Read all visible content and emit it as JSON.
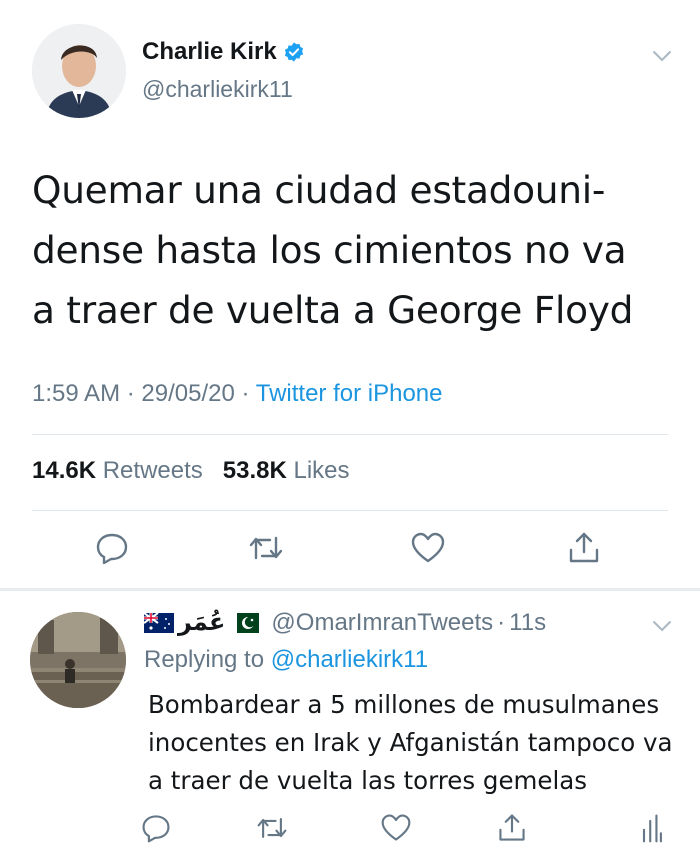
{
  "main_tweet": {
    "display_name": "Charlie Kirk",
    "handle": "@charliekirk11",
    "text": "Quemar una ciudad estadouni-\ndense hasta los cimientos no va\na traer de vuelta a George Floyd",
    "time": "1:59 AM",
    "date": "29/05/20",
    "separator": "·",
    "source": "Twitter for iPhone",
    "retweets_count": "14.6K",
    "retweets_label": "Retweets",
    "likes_count": "53.8K",
    "likes_label": "Likes"
  },
  "reply": {
    "display_name": "عُمَر",
    "handle": "@OmarImranTweets",
    "time": "11s",
    "separator": "·",
    "replying_label": "Replying to",
    "replying_to": "@charliekirk11",
    "text": "Bombardear a 5 millones de musulmanes\ninocentes en Irak y Afganistán tampoco va\na traer de vuelta las torres gemelas"
  },
  "icons": {
    "verified": "verified-badge-icon",
    "caret": "chevron-down-icon",
    "reply": "reply-icon",
    "retweet": "retweet-icon",
    "like": "heart-icon",
    "share": "share-icon",
    "analytics": "analytics-icon"
  },
  "colors": {
    "text": "#14171a",
    "secondary": "#657786",
    "link": "#1b95e0",
    "divider": "#e1e8ed"
  }
}
